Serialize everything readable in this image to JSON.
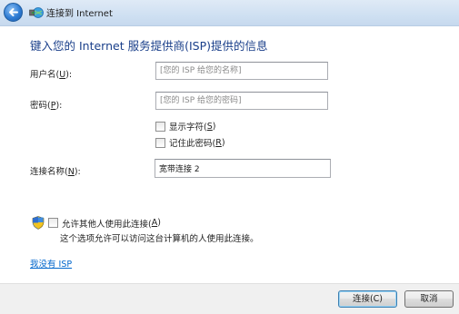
{
  "window": {
    "title": "连接到 Internet"
  },
  "page": {
    "heading": "键入您的 Internet 服务提供商(ISP)提供的信息"
  },
  "form": {
    "username": {
      "label": "用户名(",
      "accel": "U",
      "suffix": "):",
      "value": "",
      "placeholder": "[您的 ISP 给您的名称]"
    },
    "password": {
      "label": "密码(",
      "accel": "P",
      "suffix": "):",
      "value": "",
      "placeholder": "[您的 ISP 给您的密码]"
    },
    "show_chars": {
      "label": "显示字符(",
      "accel": "S",
      "suffix": ")",
      "checked": false
    },
    "remember": {
      "label": "记住此密码(",
      "accel": "R",
      "suffix": ")",
      "checked": false
    },
    "conn_name": {
      "label": "连接名称(",
      "accel": "N",
      "suffix": "):",
      "value": "宽带连接 2"
    },
    "allow_others": {
      "label": "允许其他人使用此连接(",
      "accel": "A",
      "suffix": ")",
      "checked": false,
      "description": "这个选项允许可以访问这台计算机的人使用此连接。"
    }
  },
  "links": {
    "no_isp": "我没有 ISP"
  },
  "buttons": {
    "connect": "连接(C)",
    "cancel": "取消"
  },
  "icons": {
    "back": "back-arrow-icon",
    "network": "network-globe-icon",
    "shield": "uac-shield-icon"
  },
  "colors": {
    "heading": "#1a3f8a",
    "link": "#0066cc",
    "titlebar": "#cfe0f2"
  }
}
